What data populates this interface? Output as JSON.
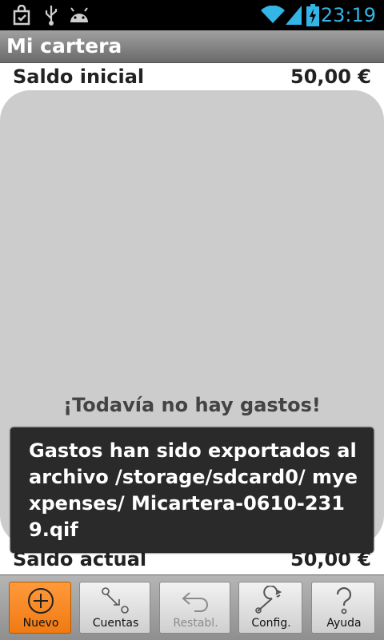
{
  "status_bar": {
    "time": "23:19",
    "icons": [
      "shopping-bag-icon",
      "usb-icon",
      "android-icon",
      "wifi-icon",
      "signal-icon",
      "battery-charging-icon"
    ]
  },
  "app": {
    "title": "Mi cartera"
  },
  "balance": {
    "initial_label": "Saldo inicial",
    "initial_value": "50,00 €",
    "current_label": "Saldo actual",
    "current_value": "50,00 €"
  },
  "list": {
    "empty_message": "¡Todavía no hay gastos!"
  },
  "toast": {
    "message": "Gastos han sido exportados al archivo /storage/sdcard0/ myexpenses/ Micartera-0610-2319.qif"
  },
  "toolbar": {
    "buttons": [
      {
        "label": "Nuevo",
        "icon": "add-circle-icon",
        "state": "active"
      },
      {
        "label": "Cuentas",
        "icon": "accounts-icon",
        "state": "normal"
      },
      {
        "label": "Restabl.",
        "icon": "undo-icon",
        "state": "disabled"
      },
      {
        "label": "Config.",
        "icon": "wrench-icon",
        "state": "normal"
      },
      {
        "label": "Ayuda",
        "icon": "help-icon",
        "state": "normal"
      }
    ]
  },
  "colors": {
    "accent": "#33b5e5",
    "primary_button": "#f58a20",
    "list_background": "#cccccc",
    "toast_background": "#2a2a2a"
  }
}
